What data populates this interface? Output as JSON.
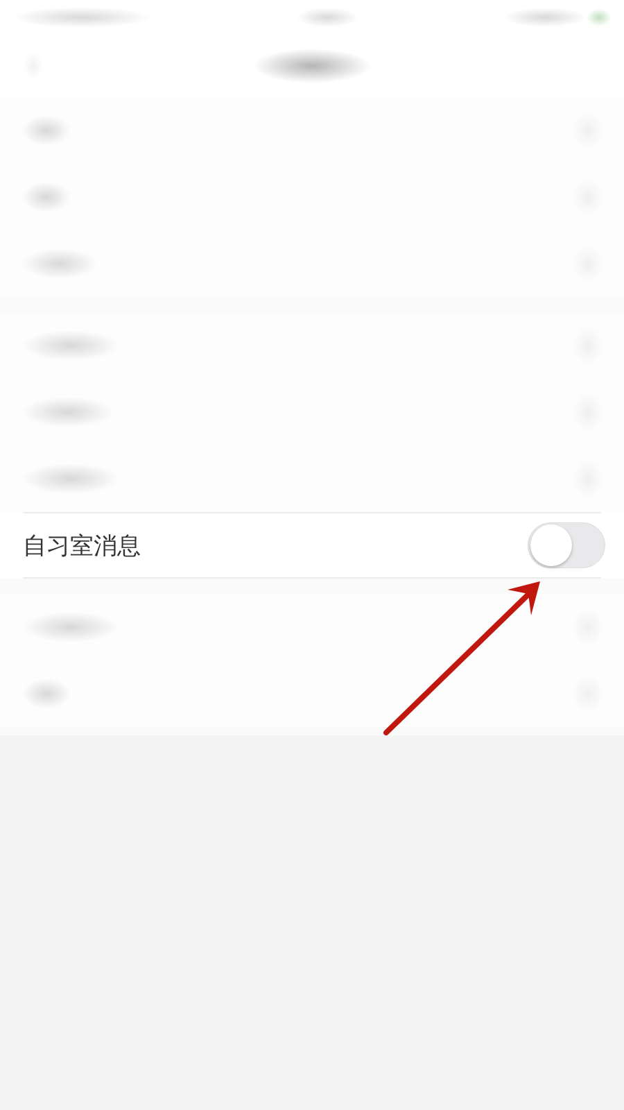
{
  "status_bar": {
    "blurred": true
  },
  "nav_bar": {
    "blurred": true
  },
  "groups": [
    {
      "rows": [
        {
          "kind": "blurred"
        },
        {
          "kind": "blurred"
        },
        {
          "kind": "blurred"
        }
      ]
    },
    {
      "rows": [
        {
          "kind": "blurred"
        },
        {
          "kind": "blurred"
        },
        {
          "kind": "blurred"
        },
        {
          "kind": "switch",
          "label": "自习室消息",
          "on": false
        }
      ]
    },
    {
      "rows": [
        {
          "kind": "blurred"
        },
        {
          "kind": "blurred"
        }
      ]
    }
  ]
}
